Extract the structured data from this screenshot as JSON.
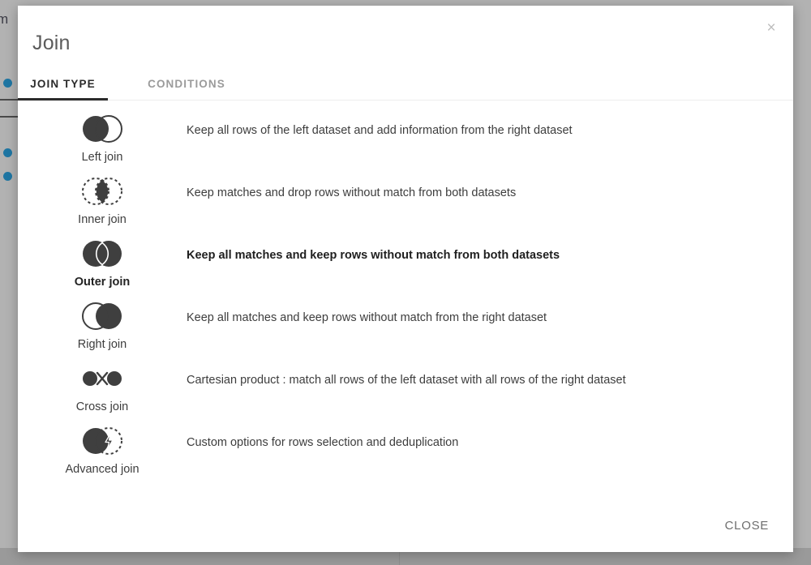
{
  "background": {
    "partial_text": "m"
  },
  "modal": {
    "title": "Join",
    "close_icon_label": "×",
    "tabs": [
      {
        "label": "JOIN TYPE",
        "active": true
      },
      {
        "label": "CONDITIONS",
        "active": false
      }
    ],
    "join_types": [
      {
        "label": "Left join",
        "icon": "venn-left-join-icon",
        "description": "Keep all rows of the left dataset and add information from the right dataset",
        "selected": false
      },
      {
        "label": "Inner join",
        "icon": "venn-inner-join-icon",
        "description": "Keep matches and drop rows without match from both datasets",
        "selected": false
      },
      {
        "label": "Outer join",
        "icon": "venn-outer-join-icon",
        "description": "Keep all matches and keep rows without match from both datasets",
        "selected": true
      },
      {
        "label": "Right join",
        "icon": "venn-right-join-icon",
        "description": "Keep all matches and keep rows without match from the right dataset",
        "selected": false
      },
      {
        "label": "Cross join",
        "icon": "cross-join-icon",
        "description": "Cartesian product : match all rows of the left dataset with all rows of the right dataset",
        "selected": false
      },
      {
        "label": "Advanced join",
        "icon": "advanced-join-icon",
        "description": "Custom options for rows selection and deduplication",
        "selected": false
      }
    ],
    "footer": {
      "close_label": "CLOSE"
    }
  },
  "colors": {
    "icon_fill": "#3f3f3f",
    "accent_underline": "#2b2b2b",
    "backdrop": "#b2b2b2",
    "bg_dot": "#1f76a3"
  }
}
